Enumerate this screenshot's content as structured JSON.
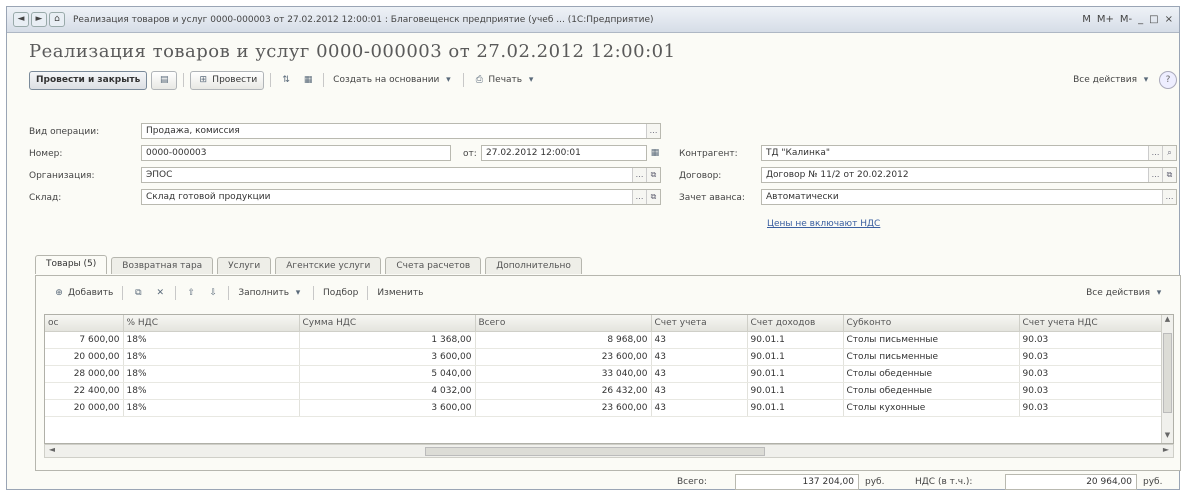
{
  "window": {
    "title": "Реализация товаров и услуг 0000-000003 от 27.02.2012 12:00:01 : Благовещенск предприятие (учеб ... (1С:Предприятие)",
    "controls": [
      "M",
      "M+",
      "M-",
      "_",
      "□",
      "×"
    ]
  },
  "document": {
    "title": "Реализация товаров и услуг 0000-000003 от 27.02.2012 12:00:01"
  },
  "toolbar": {
    "post_close": "Провести и закрыть",
    "post": "Провести",
    "create_based_on": "Создать на основании",
    "print": "Печать",
    "all_actions": "Все действия"
  },
  "form": {
    "operation_label": "Вид операции:",
    "operation_value": "Продажа, комиссия",
    "number_label": "Номер:",
    "number_value": "0000-000003",
    "date_prefix": "от:",
    "date_value": "27.02.2012 12:00:01",
    "counterparty_label": "Контрагент:",
    "counterparty_value": "ТД \"Калинка\"",
    "organization_label": "Организация:",
    "organization_value": "ЭПОС",
    "contract_label": "Договор:",
    "contract_value": "Договор № 11/2 от 20.02.2012",
    "warehouse_label": "Склад:",
    "warehouse_value": "Склад готовой продукции",
    "advance_label": "Зачет аванса:",
    "advance_value": "Автоматически",
    "price_link": "Цены не включают НДС"
  },
  "tabs": [
    "Товары (5)",
    "Возвратная тара",
    "Услуги",
    "Агентские услуги",
    "Счета расчетов",
    "Дополнительно"
  ],
  "panel_toolbar": {
    "add": "Добавить",
    "fill": "Заполнить",
    "select": "Подбор",
    "change": "Изменить",
    "all_actions": "Все действия"
  },
  "table": {
    "headers": [
      "ос",
      "% НДС",
      "Сумма НДС",
      "Всего",
      "Счет учета",
      "Счет доходов",
      "Субконто",
      "Счет учета НДС"
    ],
    "rows": [
      [
        "7 600,00",
        "18%",
        "1 368,00",
        "8 968,00",
        "43",
        "90.01.1",
        "Столы письменные",
        "90.03"
      ],
      [
        "20 000,00",
        "18%",
        "3 600,00",
        "23 600,00",
        "43",
        "90.01.1",
        "Столы письменные",
        "90.03"
      ],
      [
        "28 000,00",
        "18%",
        "5 040,00",
        "33 040,00",
        "43",
        "90.01.1",
        "Столы обеденные",
        "90.03"
      ],
      [
        "22 400,00",
        "18%",
        "4 032,00",
        "26 432,00",
        "43",
        "90.01.1",
        "Столы обеденные",
        "90.03"
      ],
      [
        "20 000,00",
        "18%",
        "3 600,00",
        "23 600,00",
        "43",
        "90.01.1",
        "Столы кухонные",
        "90.03"
      ]
    ]
  },
  "totals": {
    "total_label": "Всего:",
    "total_value": "137 204,00",
    "currency": "руб.",
    "vat_label": "НДС (в т.ч.):",
    "vat_value": "20 964,00",
    "vat_currency": "руб."
  }
}
